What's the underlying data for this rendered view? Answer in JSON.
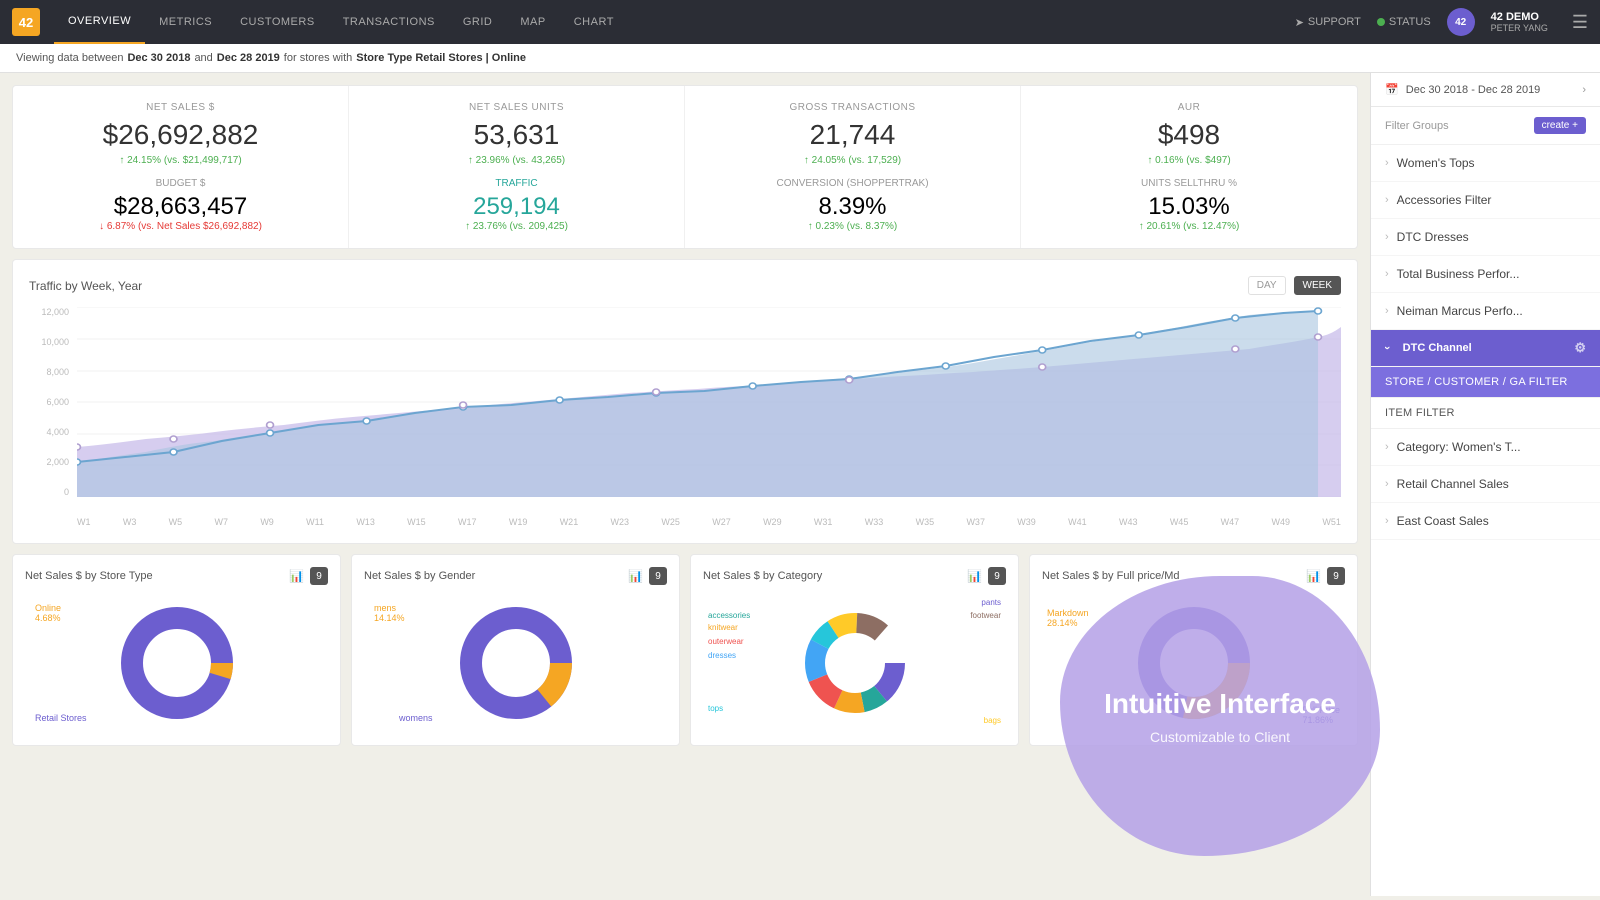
{
  "nav": {
    "logo": "42",
    "items": [
      {
        "label": "OVERVIEW",
        "active": true
      },
      {
        "label": "METRICS",
        "active": false
      },
      {
        "label": "CUSTOMERS",
        "active": false
      },
      {
        "label": "TRANSACTIONS",
        "active": false
      },
      {
        "label": "GRID",
        "active": false
      },
      {
        "label": "MAP",
        "active": false
      },
      {
        "label": "CHART",
        "active": false
      }
    ],
    "support_label": "SUPPORT",
    "status_label": "STATUS",
    "user_name": "42 DEMO",
    "user_sub": "PETER YANG"
  },
  "filter_bar": {
    "viewing": "Viewing data between",
    "date_from": "Dec 30 2018",
    "and": "and",
    "date_to": "Dec 28 2019",
    "for_stores": "for stores with",
    "store_filter": "Store Type Retail Stores | Online"
  },
  "kpis": [
    {
      "label": "NET SALES $",
      "value": "$26,692,882",
      "delta": "↑ 24.15% (vs. $21,499,717)",
      "delta_type": "up",
      "sub_label": "BUDGET $",
      "sub_value": "$28,663,457",
      "sub_delta": "↓ 6.87% (vs. Net Sales $26,692,882)",
      "sub_delta_type": "down"
    },
    {
      "label": "NET SALES UNITS",
      "value": "53,631",
      "delta": "↑ 23.96% (vs. 43,265)",
      "delta_type": "up",
      "sub_label": "TRAFFIC",
      "sub_value": "259,194",
      "sub_delta": "↑ 23.76% (vs. 209,425)",
      "sub_delta_type": "up",
      "traffic": true
    },
    {
      "label": "GROSS TRANSACTIONS",
      "value": "21,744",
      "delta": "↑ 24.05% (vs. 17,529)",
      "delta_type": "up",
      "sub_label": "CONVERSION (SHOPPERTRAK)",
      "sub_value": "8.39%",
      "sub_delta": "↑ 0.23% (vs. 8.37%)",
      "sub_delta_type": "up"
    },
    {
      "label": "AUR",
      "value": "$498",
      "delta": "↑ 0.16% (vs. $497)",
      "delta_type": "up",
      "sub_label": "UNITS SELLTHRU %",
      "sub_value": "15.03%",
      "sub_delta": "↑ 20.61% (vs. 12.47%)",
      "sub_delta_type": "up"
    }
  ],
  "traffic_chart": {
    "title": "Traffic by Week, Year",
    "day_label": "DAY",
    "week_label": "WEEK",
    "y_labels": [
      "12,000",
      "10,000",
      "8,000",
      "6,000",
      "4,000",
      "2,000",
      "0"
    ],
    "x_labels": [
      "W1",
      "W3",
      "W5",
      "W7",
      "W9",
      "W11",
      "W13",
      "W15",
      "W17",
      "W19",
      "W21",
      "W23",
      "W25",
      "W27",
      "W29",
      "W31",
      "W33",
      "W35",
      "W37",
      "W39",
      "W41",
      "W43",
      "W45",
      "W47",
      "W49",
      "W51"
    ]
  },
  "bottom_charts": [
    {
      "title": "Net Sales $ by Store Type",
      "badge": "9",
      "labels": [
        "Online 4.68%",
        "Retail Stores"
      ],
      "colors": [
        "#f5a623",
        "#6c5ecf"
      ]
    },
    {
      "title": "Net Sales $ by Gender",
      "badge": "9",
      "labels": [
        "mens 14.14%",
        "womens"
      ],
      "colors": [
        "#f5a623",
        "#6c5ecf"
      ]
    },
    {
      "title": "Net Sales $ by Category",
      "badge": "9",
      "labels": [
        "pants",
        "accessories",
        "knitwear",
        "outerwear",
        "dresses",
        "tops",
        "bags",
        "footwear"
      ],
      "colors": [
        "#6c5ecf",
        "#26a69a",
        "#f5a623",
        "#ef5350",
        "#42a5f5",
        "#26c6da",
        "#ffca28",
        "#8d6e63"
      ]
    },
    {
      "title": "Net Sales $ by Full price/Md",
      "badge": "9",
      "labels": [
        "Markdown 28.14%",
        "Full Price 71.86%"
      ],
      "colors": [
        "#f5a623",
        "#6c5ecf"
      ]
    }
  ],
  "sidebar": {
    "date_range": "Dec 30 2018 - Dec 28 2019",
    "filter_groups_label": "Filter Groups",
    "create_label": "create +",
    "items": [
      {
        "label": "Women's Tops",
        "active": false
      },
      {
        "label": "Accessories Filter",
        "active": false
      },
      {
        "label": "DTC Dresses",
        "active": false
      },
      {
        "label": "Total Business Perfor...",
        "active": false
      },
      {
        "label": "Neiman Marcus Perfo...",
        "active": false
      }
    ],
    "active_group": "DTC Channel",
    "sub_items": [
      {
        "label": "STORE / CUSTOMER / GA FILTER",
        "selected": true
      },
      {
        "label": "ITEM FILTER",
        "selected": false
      }
    ],
    "more_items": [
      {
        "label": "Category: Women's T..."
      },
      {
        "label": "Retail Channel Sales"
      },
      {
        "label": "East Coast Sales"
      }
    ]
  },
  "overlay": {
    "title": "Intuitive Interface",
    "subtitle": "Customizable to Client"
  }
}
